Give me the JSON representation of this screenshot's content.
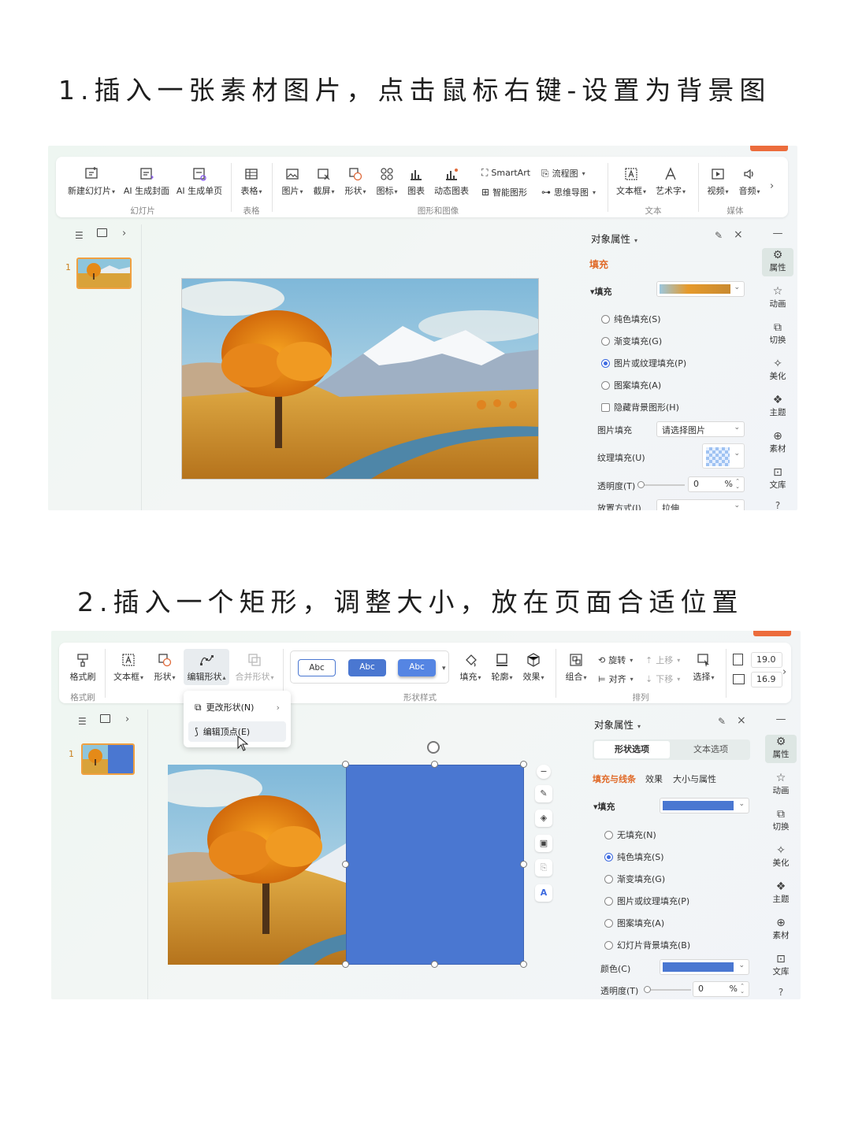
{
  "step1": {
    "title": "1.插入一张素材图片，点击鼠标右键-设置为背景图",
    "ribbon": {
      "buttons": [
        {
          "label": "新建幻灯片",
          "caret": true
        },
        {
          "label": "AI 生成封面"
        },
        {
          "label": "AI 生成单页"
        },
        {
          "label": "表格",
          "caret": true
        },
        {
          "label": "图片",
          "caret": true
        },
        {
          "label": "截屏",
          "caret": true
        },
        {
          "label": "形状",
          "caret": true
        },
        {
          "label": "图标",
          "caret": true
        },
        {
          "label": "图表"
        },
        {
          "label": "动态图表"
        },
        {
          "label": "文本框",
          "caret": true
        },
        {
          "label": "艺术字",
          "caret": true
        },
        {
          "label": "视频",
          "caret": true
        },
        {
          "label": "音频",
          "caret": true
        }
      ],
      "small": [
        "SmartArt",
        "智能图形",
        "流程图",
        "思维导图"
      ],
      "groups": [
        "幻灯片",
        "表格",
        "图形和图像",
        "文本",
        "媒体"
      ]
    },
    "slide_number": "1",
    "panel": {
      "title": "对象属性",
      "tab": "填充",
      "section": "填充",
      "options": [
        {
          "label": "纯色填充(S)",
          "checked": false
        },
        {
          "label": "渐变填充(G)",
          "checked": false
        },
        {
          "label": "图片或纹理填充(P)",
          "checked": true
        },
        {
          "label": "图案填充(A)",
          "checked": false
        }
      ],
      "hide_bg": "隐藏背景图形(H)",
      "picture_fill_label": "图片填充",
      "picture_fill_value": "请选择图片",
      "texture_fill_label": "纹理填充(U)",
      "transparency_label": "透明度(T)",
      "transparency_value": "0",
      "percent": "%",
      "placement_label": "放置方式(I)",
      "placement_value": "拉伸"
    },
    "right_bar": [
      "属性",
      "动画",
      "切换",
      "美化",
      "主题",
      "素材",
      "文库"
    ]
  },
  "step2": {
    "title": "2.插入一个矩形，调整大小，放在页面合适位置",
    "ribbon": {
      "buttons": [
        {
          "label": "格式刷"
        },
        {
          "label": "文本框",
          "caret": true
        },
        {
          "label": "形状",
          "caret": true
        },
        {
          "label": "编辑形状",
          "caret": true
        },
        {
          "label": "合并形状",
          "caret": true
        },
        {
          "label": "填充",
          "caret": true
        },
        {
          "label": "轮廓",
          "caret": true
        },
        {
          "label": "效果",
          "caret": true
        },
        {
          "label": "组合",
          "caret": true
        },
        {
          "label": "选择",
          "caret": true
        }
      ],
      "style_samples": [
        "Abc",
        "Abc",
        "Abc"
      ],
      "small": [
        "旋转",
        "对齐",
        "上移",
        "下移"
      ],
      "size_w": "19.0",
      "size_h": "16.9",
      "groups": [
        "格式刷",
        "形状样式",
        "排列"
      ]
    },
    "context_menu": [
      "更改形状(N)",
      "编辑顶点(E)"
    ],
    "slide_number": "1",
    "panel": {
      "title": "对象属性",
      "tabs": [
        "形状选项",
        "文本选项"
      ],
      "subtabs": [
        "填充与线条",
        "效果",
        "大小与属性"
      ],
      "section": "填充",
      "options": [
        {
          "label": "无填充(N)",
          "checked": false
        },
        {
          "label": "纯色填充(S)",
          "checked": true
        },
        {
          "label": "渐变填充(G)",
          "checked": false
        },
        {
          "label": "图片或纹理填充(P)",
          "checked": false
        },
        {
          "label": "图案填充(A)",
          "checked": false
        },
        {
          "label": "幻灯片背景填充(B)",
          "checked": false
        }
      ],
      "color_label": "颜色(C)",
      "transparency_label": "透明度(T)",
      "transparency_value": "0",
      "percent": "%"
    },
    "right_bar": [
      "属性",
      "动画",
      "切换",
      "美化",
      "主题",
      "素材",
      "文库"
    ]
  },
  "colors": {
    "shape_blue": "#4a77d1",
    "accent_orange": "#ec6c3c",
    "radio_blue": "#3d6ae0"
  }
}
